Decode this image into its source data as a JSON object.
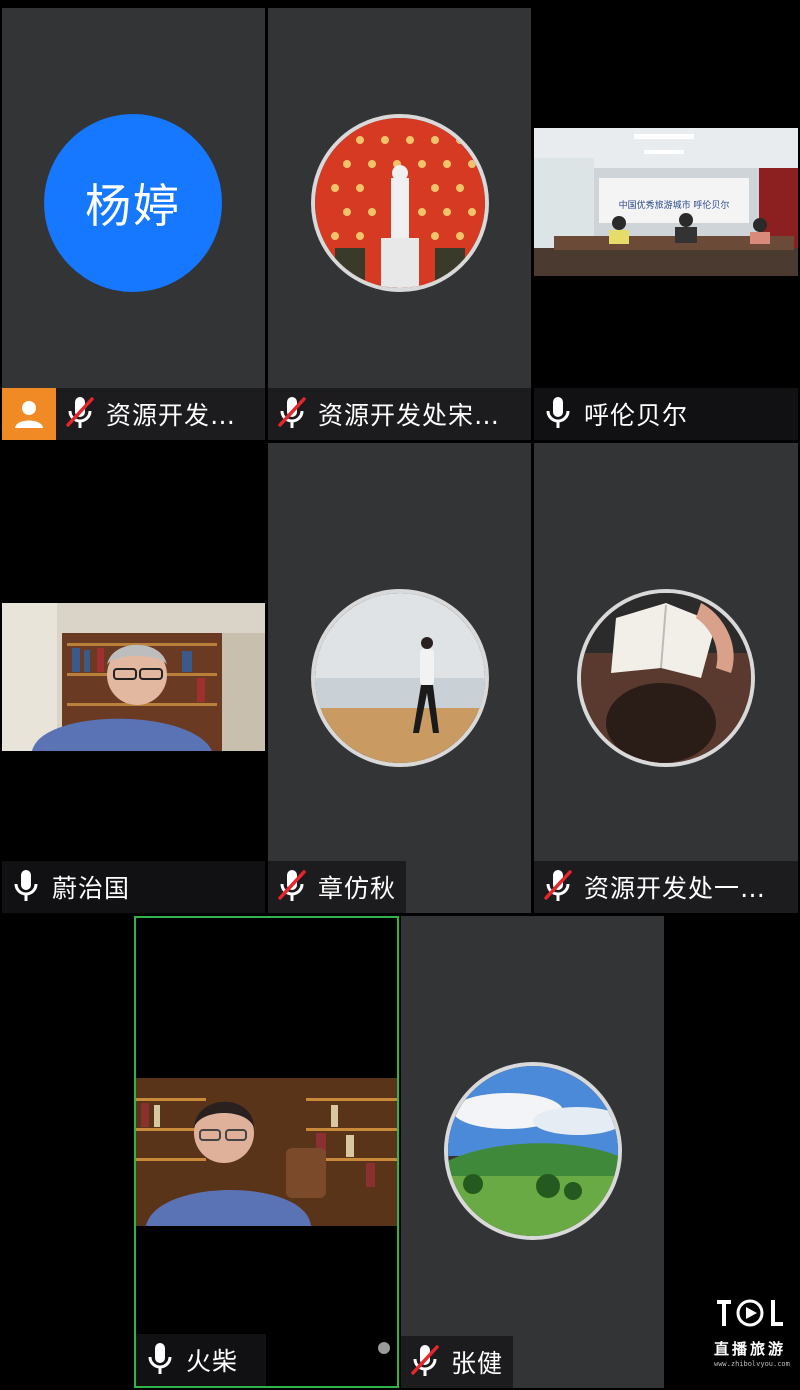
{
  "participants": [
    {
      "name": "资源开发…",
      "avatar_text": "杨婷",
      "mic": "muted",
      "host": true
    },
    {
      "name": "资源开发处宋…",
      "mic": "muted",
      "avatar_icon": "statue-photo"
    },
    {
      "name": "呼伦贝尔",
      "mic": "on",
      "video_icon": "conference-room-video",
      "banner_text": "中国优秀旅游城市 呼伦贝尔"
    },
    {
      "name": "蔚治国",
      "mic": "on",
      "video_icon": "man-with-bookshelf-video"
    },
    {
      "name": "章仿秋",
      "mic": "muted",
      "avatar_icon": "woman-walking-desert-photo"
    },
    {
      "name": "资源开发处一…",
      "mic": "muted",
      "avatar_icon": "person-reading-book-photo"
    },
    {
      "name": "火柴",
      "mic": "on",
      "video_icon": "man-with-bookshelf-video",
      "active_speaker": true
    },
    {
      "name": "张健",
      "mic": "muted",
      "avatar_icon": "green-grassland-photo"
    }
  ],
  "watermark": {
    "text": "直播旅游",
    "url": "www.zhibolvyou.com"
  },
  "colors": {
    "tile_gray": "#333436",
    "active_border": "#31b24a",
    "host_badge": "#f08a24",
    "avatar_blue": "#1677ff",
    "mute_red": "#e5262b"
  }
}
